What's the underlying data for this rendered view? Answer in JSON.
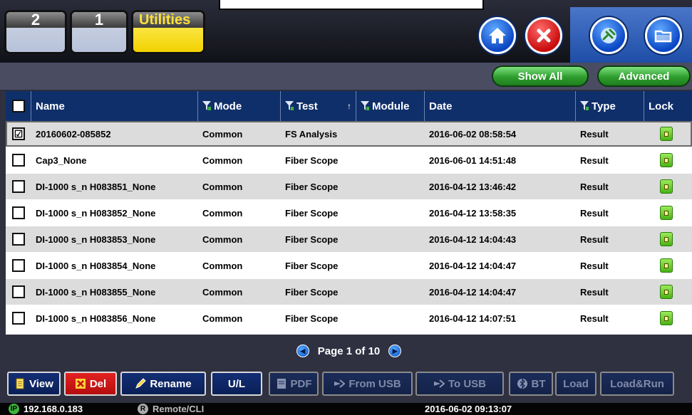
{
  "tabs": [
    {
      "label": "2"
    },
    {
      "label": "1"
    },
    {
      "label": "Utilities"
    }
  ],
  "toolbar": {
    "show_all": "Show All",
    "advanced": "Advanced"
  },
  "table": {
    "headers": {
      "name": "Name",
      "mode": "Mode",
      "test": "Test",
      "test_sort": "↑",
      "module": "Module",
      "date": "Date",
      "type": "Type",
      "lock": "Lock"
    },
    "rows": [
      {
        "checked": "☑",
        "name": "20160602-085852",
        "mode": "Common",
        "test": "FS Analysis",
        "module": "",
        "date": "2016-06-02 08:58:54",
        "type": "Result"
      },
      {
        "checked": "",
        "name": "Cap3_None",
        "mode": "Common",
        "test": "Fiber Scope",
        "module": "",
        "date": "2016-06-01 14:51:48",
        "type": "Result"
      },
      {
        "checked": "",
        "name": "DI-1000 s_n H083851_None",
        "mode": "Common",
        "test": "Fiber Scope",
        "module": "",
        "date": "2016-04-12 13:46:42",
        "type": "Result"
      },
      {
        "checked": "",
        "name": "DI-1000 s_n H083852_None",
        "mode": "Common",
        "test": "Fiber Scope",
        "module": "",
        "date": "2016-04-12 13:58:35",
        "type": "Result"
      },
      {
        "checked": "",
        "name": "DI-1000 s_n H083853_None",
        "mode": "Common",
        "test": "Fiber Scope",
        "module": "",
        "date": "2016-04-12 14:04:43",
        "type": "Result"
      },
      {
        "checked": "",
        "name": "DI-1000 s_n H083854_None",
        "mode": "Common",
        "test": "Fiber Scope",
        "module": "",
        "date": "2016-04-12 14:04:47",
        "type": "Result"
      },
      {
        "checked": "",
        "name": "DI-1000 s_n H083855_None",
        "mode": "Common",
        "test": "Fiber Scope",
        "module": "",
        "date": "2016-04-12 14:04:47",
        "type": "Result"
      },
      {
        "checked": "",
        "name": "DI-1000 s_n H083856_None",
        "mode": "Common",
        "test": "Fiber Scope",
        "module": "",
        "date": "2016-04-12 14:07:51",
        "type": "Result"
      }
    ]
  },
  "pager": {
    "text": "Page 1 of 10"
  },
  "buttons": {
    "view": "View",
    "del": "Del",
    "rename": "Rename",
    "ul": "U/L",
    "pdf": "PDF",
    "from_usb": "From USB",
    "to_usb": "To USB",
    "bt": "BT",
    "load": "Load",
    "load_run": "Load&Run"
  },
  "status": {
    "ip_badge": "IP",
    "ip": "192.168.0.183",
    "remote_badge": "R",
    "remote": "Remote/CLI",
    "datetime": "2016-06-02  09:13:07"
  },
  "colors": {
    "header_blue": "#0f2f6a",
    "accent_green": "#2e9d2e",
    "row_alt": "#dcdcdc",
    "del_red": "#c90d0d"
  }
}
